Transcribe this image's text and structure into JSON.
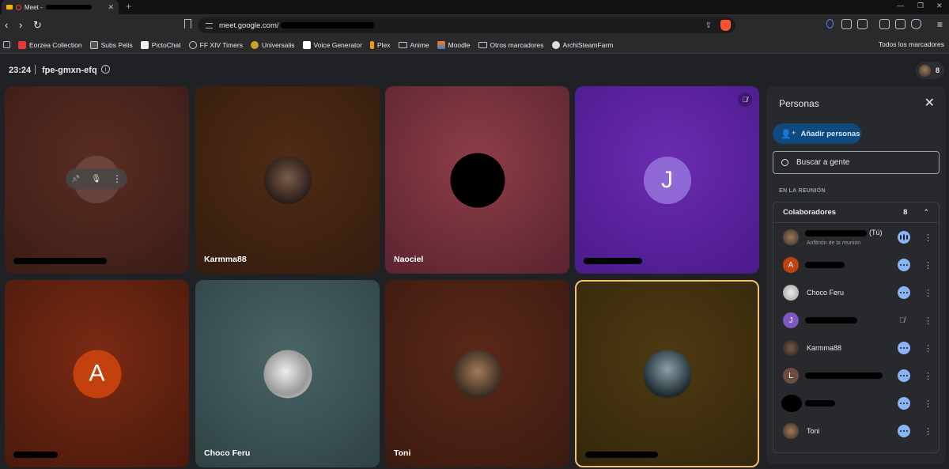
{
  "browser": {
    "tab_title": "Meet -",
    "url": "meet.google.com/",
    "bookmarks": [
      "Eorzea Collection",
      "Subs Pelis",
      "PictoChat",
      "FF XIV Timers",
      "Universalis",
      "Voice Generator",
      "Plex",
      "Anime",
      "Moodle",
      "Otros marcadores",
      "ArchiSteamFarm"
    ],
    "bookmarks_right": "Todos los marcadores"
  },
  "meet": {
    "time": "23:24",
    "meeting_code": "fpe-gmxn-efq",
    "participant_count": "8",
    "tiles": [
      {
        "name": ""
      },
      {
        "name": "Karmma88"
      },
      {
        "name": "Naociel"
      },
      {
        "name": "",
        "letter": "J"
      },
      {
        "name": "",
        "letter": "A"
      },
      {
        "name": "Choco Feru"
      },
      {
        "name": "Toni"
      },
      {
        "name": ""
      }
    ],
    "hover_controls": {
      "pin": "📌",
      "mic": "🎙",
      "more": "⋮"
    }
  },
  "panel": {
    "title": "Personas",
    "close": "✕",
    "add_people": "Añadir personas",
    "search_placeholder": "Buscar a gente",
    "section_label": "EN LA REUNIÓN",
    "group_label": "Colaboradores",
    "group_count": "8",
    "you_suffix": "(Tú)",
    "host_label": "Anfitrión de la reunión",
    "people": [
      {
        "name": "",
        "letter": ""
      },
      {
        "name": "",
        "letter": "A"
      },
      {
        "name": "Choco Feru",
        "letter": ""
      },
      {
        "name": "",
        "letter": "J"
      },
      {
        "name": "Karmma88",
        "letter": ""
      },
      {
        "name": "",
        "letter": "L"
      },
      {
        "name": "",
        "letter": ""
      },
      {
        "name": "Toni",
        "letter": ""
      }
    ]
  },
  "colors": {
    "accent_blue": "#8ab4f8",
    "active_speaker_border": "#f5c26b",
    "purple_avatar": "#7e57c2",
    "orange_avatar": "#d84315"
  }
}
